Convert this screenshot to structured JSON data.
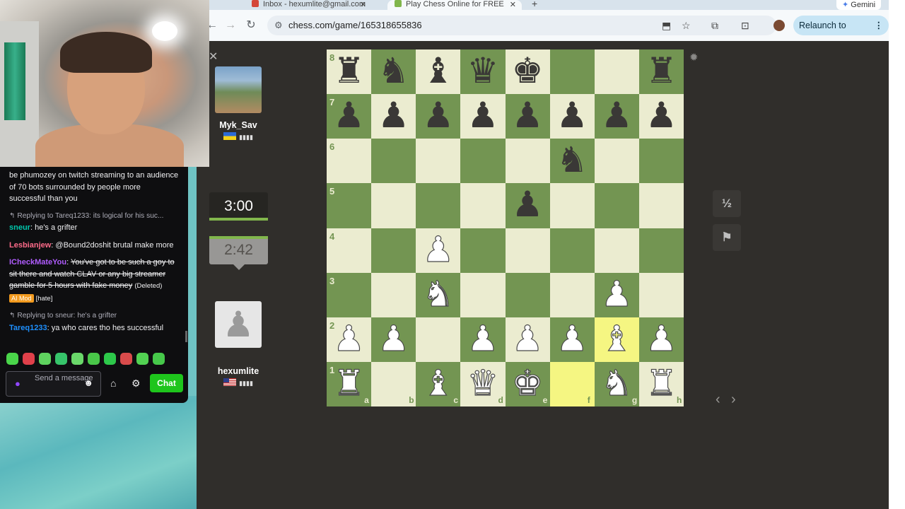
{
  "browser": {
    "tabs": [
      {
        "label": "Inbox - hexumlite@gmail.com",
        "icon": "gmail-icon"
      },
      {
        "label": "Play Chess Online for FREE",
        "icon": "chesscom-icon"
      }
    ],
    "profile_button": "Gemini",
    "url": "chess.com/game/165318655836",
    "relaunch_label": "Relaunch to update"
  },
  "game": {
    "opponent": {
      "name": "Myk_Sav",
      "country": "Ukraine",
      "clock": "3:00"
    },
    "player": {
      "name": "hexumlite",
      "country": "United States",
      "clock": "2:42"
    },
    "signal": "▮▮▮▮",
    "draw_label": "½",
    "ranks": [
      "8",
      "7",
      "6",
      "5",
      "4",
      "3",
      "2",
      "1"
    ],
    "files": [
      "a",
      "b",
      "c",
      "d",
      "e",
      "f",
      "g",
      "h"
    ],
    "position": [
      "rnbqk..r",
      "pppppppp",
      ".....n..",
      "....p...",
      "..P.....",
      "..N...P.",
      "PP.PPPBP",
      "R.BQK.NR"
    ],
    "last_move": [
      "f1",
      "g2"
    ],
    "colors": {
      "light": "#ebecd0",
      "dark": "#739552",
      "highlight_light": "#f5f682",
      "highlight_dark": "#b9ca43",
      "timer_bar": "#81b64c"
    }
  },
  "chat": {
    "messages": [
      {
        "text": "be phumozey on twitch streaming to an audience of 70 bots surrounded by people more successful than you"
      },
      {
        "reply": "Replying to Tareq1233: its logical for his suc...",
        "user": "sneur",
        "color": "#00c7ac",
        "text": "he's a grifter"
      },
      {
        "user": "Lesbianjew",
        "color": "#ff6b8a",
        "text": "@Bound2doshit brutal make more"
      },
      {
        "user": "ICheckMateYou",
        "color": "#b05cff",
        "text": "You've got to be such a goy to sit there and watch CLAV or any big streamer gamble for 5 hours with fake money",
        "deleted": "(Deleted)",
        "badge": "AI Mod",
        "tag": "[hate]"
      },
      {
        "reply": "Replying to sneur: he's a grifter",
        "user": "Tareq1233",
        "color": "#1e90ff",
        "text": "ya who cares tho hes successful"
      }
    ],
    "input_placeholder": "Send a message",
    "send_label": "Chat",
    "emote_colors": [
      "#4ad54a",
      "#e0404a",
      "#5fd35f",
      "#36c46a",
      "#6ad86a",
      "#49c749",
      "#2dc84a",
      "#d94b4b",
      "#52d152",
      "#46c84a"
    ]
  }
}
